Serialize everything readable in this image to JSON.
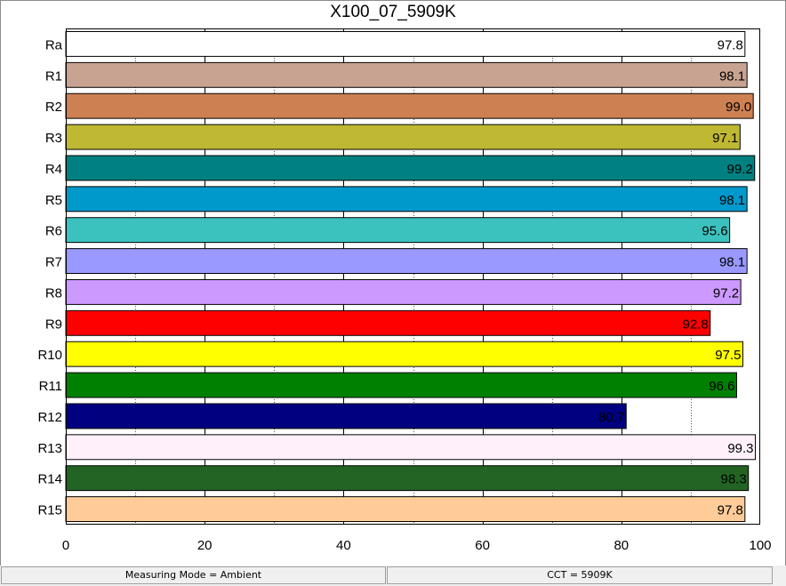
{
  "window": {
    "title": "X100_07_5909K"
  },
  "chart_data": {
    "type": "bar",
    "orientation": "horizontal",
    "title": "X100_07_5909K",
    "xlim": [
      0,
      100
    ],
    "x_ticks": [
      0,
      20,
      40,
      60,
      80,
      100
    ],
    "grid": "vertical dotted lines every 10, solid every 20",
    "categories": [
      "Ra",
      "R1",
      "R2",
      "R3",
      "R4",
      "R5",
      "R6",
      "R7",
      "R8",
      "R9",
      "R10",
      "R11",
      "R12",
      "R13",
      "R14",
      "R15"
    ],
    "values": [
      97.8,
      98.1,
      99.0,
      97.1,
      99.2,
      98.1,
      95.6,
      98.1,
      97.2,
      92.8,
      97.5,
      96.6,
      80.7,
      99.3,
      98.3,
      97.8
    ],
    "value_labels": [
      "97.8",
      "98.1",
      "99.0",
      "97.1",
      "99.2",
      "98.1",
      "95.6",
      "98.1",
      "97.2",
      "92.8",
      "97.5",
      "96.6",
      "80.7",
      "99.3",
      "98.3",
      "97.8"
    ],
    "colors": [
      "#ffffff",
      "#c9a391",
      "#cd8152",
      "#bfb833",
      "#008080",
      "#0099cc",
      "#3cc2be",
      "#9999ff",
      "#cc99ff",
      "#ff0000",
      "#ffff00",
      "#008000",
      "#000080",
      "#fff0fa",
      "#236323",
      "#ffcc99"
    ]
  },
  "status_bar": {
    "measuring_mode": "Measuring Mode = Ambient",
    "cct": "CCT = 5909K"
  }
}
